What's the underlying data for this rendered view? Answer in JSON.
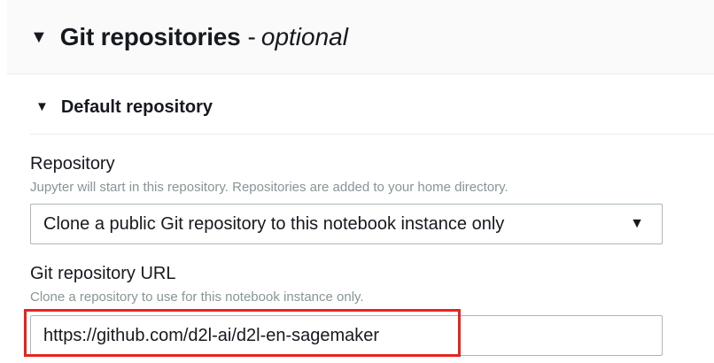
{
  "section": {
    "caret": "▼",
    "title": "Git repositories",
    "dash": "-",
    "optional": "optional"
  },
  "default_repo": {
    "caret": "▼",
    "title": "Default repository"
  },
  "repository": {
    "label": "Repository",
    "description": "Jupyter will start in this repository. Repositories are added to your home directory.",
    "selected": "Clone a public Git repository to this notebook instance only",
    "caret": "▼"
  },
  "git_url": {
    "label": "Git repository URL",
    "description": "Clone a repository to use for this notebook instance only.",
    "value": "https://github.com/d2l-ai/d2l-en-sagemaker"
  },
  "colors": {
    "highlight": "#e8231e",
    "description_text": "#879596",
    "border": "#aab7b8"
  }
}
